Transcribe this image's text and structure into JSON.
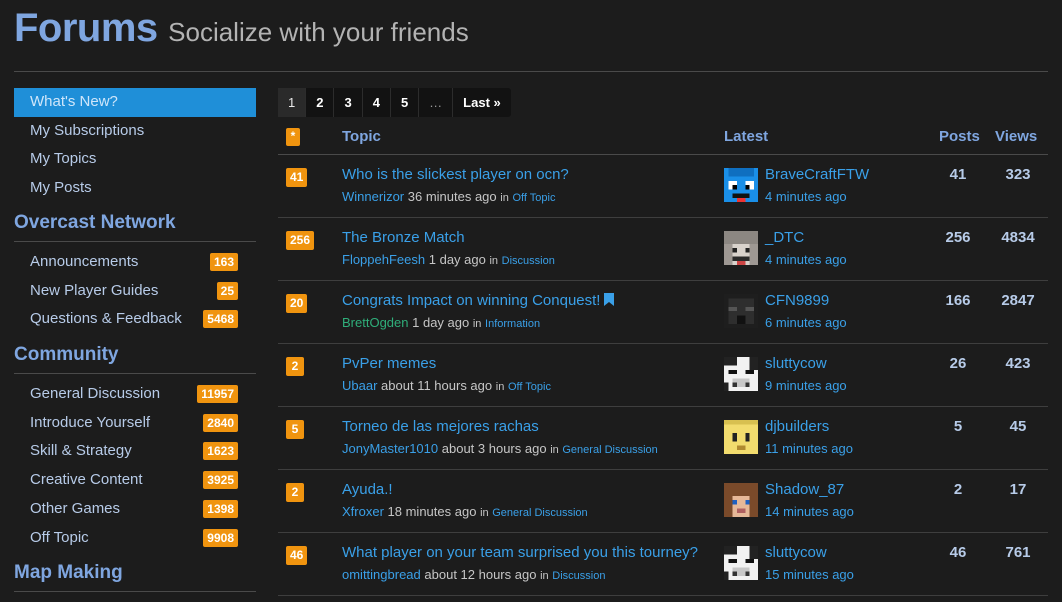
{
  "header": {
    "title": "Forums",
    "subtitle": "Socialize with your friends"
  },
  "nav": [
    {
      "label": "What's New?",
      "active": true
    },
    {
      "label": "My Subscriptions"
    },
    {
      "label": "My Topics"
    },
    {
      "label": "My Posts"
    }
  ],
  "sections": [
    {
      "title": "Overcast Network",
      "items": [
        {
          "label": "Announcements",
          "count": "163"
        },
        {
          "label": "New Player Guides",
          "count": "25"
        },
        {
          "label": "Questions & Feedback",
          "count": "5468"
        }
      ]
    },
    {
      "title": "Community",
      "items": [
        {
          "label": "General Discussion",
          "count": "11957"
        },
        {
          "label": "Introduce Yourself",
          "count": "2840"
        },
        {
          "label": "Skill & Strategy",
          "count": "1623"
        },
        {
          "label": "Creative Content",
          "count": "3925"
        },
        {
          "label": "Other Games",
          "count": "1398"
        },
        {
          "label": "Off Topic",
          "count": "9908"
        }
      ]
    },
    {
      "title": "Map Making",
      "items": []
    }
  ],
  "pagination": {
    "pages": [
      "1",
      "2",
      "3",
      "4",
      "5"
    ],
    "current": "1",
    "ellipsis": "…",
    "last": "Last »"
  },
  "table": {
    "star": "*",
    "columns": {
      "topic": "Topic",
      "latest": "Latest",
      "posts": "Posts",
      "views": "Views"
    },
    "in_word": "in",
    "rows": [
      {
        "badge": "41",
        "title": "Who is the slickest player on ocn?",
        "author": "Winnerizor",
        "author_color": "#3aa0e8",
        "age": "36 minutes ago",
        "category": "Off Topic",
        "latest_user": "BraveCraftFTW",
        "latest_time": "4 minutes ago",
        "posts": "41",
        "views": "323",
        "avatar": "blue-face"
      },
      {
        "badge": "256",
        "title": "The Bronze Match",
        "author": "FloppehFeesh",
        "author_color": "#3aa0e8",
        "age": "1 day ago",
        "category": "Discussion",
        "latest_user": "_DTC",
        "latest_time": "4 minutes ago",
        "posts": "256",
        "views": "4834",
        "avatar": "gray-hair"
      },
      {
        "badge": "20",
        "title": "Congrats Impact on winning Conquest!",
        "bookmark": true,
        "author": "BrettOgden",
        "author_color": "#2fae7a",
        "age": "1 day ago",
        "category": "Information",
        "latest_user": "CFN9899",
        "latest_time": "6 minutes ago",
        "posts": "166",
        "views": "2847",
        "avatar": "dark-mask"
      },
      {
        "badge": "2",
        "title": "PvPer memes",
        "author": "Ubaar",
        "author_color": "#3aa0e8",
        "age": "about 11 hours ago",
        "category": "Off Topic",
        "latest_user": "sluttycow",
        "latest_time": "9 minutes ago",
        "posts": "26",
        "views": "423",
        "avatar": "cow"
      },
      {
        "badge": "5",
        "title": "Torneo de las mejores rachas",
        "author": "JonyMaster1010",
        "author_color": "#3aa0e8",
        "age": "about 3 hours ago",
        "category": "General Discussion",
        "latest_user": "djbuilders",
        "latest_time": "11 minutes ago",
        "posts": "5",
        "views": "45",
        "avatar": "yellow-face"
      },
      {
        "badge": "2",
        "title": "Ayuda.!",
        "author": "Xfroxer",
        "author_color": "#3aa0e8",
        "age": "18 minutes ago",
        "category": "General Discussion",
        "latest_user": "Shadow_87",
        "latest_time": "14 minutes ago",
        "posts": "2",
        "views": "17",
        "avatar": "brown-hair"
      },
      {
        "badge": "46",
        "title": "What player on your team surprised you this tourney?",
        "author": "omittingbread",
        "author_color": "#3aa0e8",
        "age": "about 12 hours ago",
        "category": "Discussion",
        "latest_user": "sluttycow",
        "latest_time": "15 minutes ago",
        "posts": "46",
        "views": "761",
        "avatar": "cow"
      }
    ]
  },
  "colors": {
    "accent": "#7fa6e0",
    "link": "#3aa0e8",
    "badge": "#f0940f",
    "active": "#1f8fd8",
    "background": "#1c1c1c"
  }
}
